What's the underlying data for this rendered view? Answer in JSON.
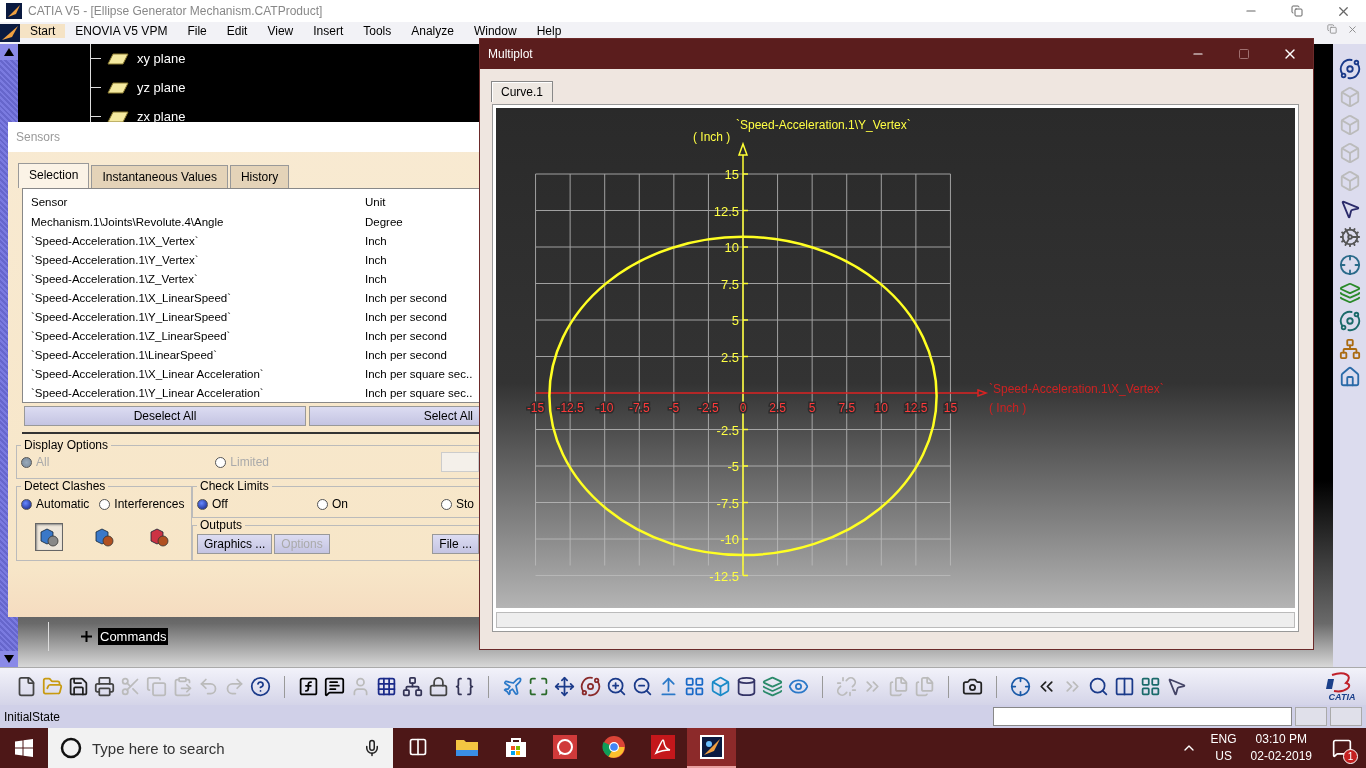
{
  "window": {
    "title": "CATIA V5 - [Ellipse Generator Mechanism.CATProduct]"
  },
  "menu": [
    {
      "label": "Start",
      "selected": true
    },
    {
      "label": "ENOVIA V5 VPM",
      "selected": false
    },
    {
      "label": "File",
      "selected": false
    },
    {
      "label": "Edit",
      "selected": false
    },
    {
      "label": "View",
      "selected": false
    },
    {
      "label": "Insert",
      "selected": false
    },
    {
      "label": "Tools",
      "selected": false
    },
    {
      "label": "Analyze",
      "selected": false
    },
    {
      "label": "Window",
      "selected": false
    },
    {
      "label": "Help",
      "selected": false
    }
  ],
  "tree": {
    "items": [
      {
        "label": "xy plane",
        "kind": "plane"
      },
      {
        "label": "yz plane",
        "kind": "plane"
      },
      {
        "label": "zx plane",
        "kind": "plane"
      },
      {
        "label": "Commands",
        "kind": "set",
        "expanded": false
      }
    ]
  },
  "sensors": {
    "title": "Sensors",
    "tabs": [
      {
        "label": "Selection",
        "selected": true
      },
      {
        "label": "Instantaneous Values",
        "selected": false
      },
      {
        "label": "History",
        "selected": false
      }
    ],
    "columns": [
      "Sensor",
      "Unit"
    ],
    "rows": [
      {
        "sensor": "Mechanism.1\\Joints\\Revolute.4\\Angle",
        "unit": "Degree"
      },
      {
        "sensor": "`Speed-Acceleration.1\\X_Vertex`",
        "unit": "Inch"
      },
      {
        "sensor": "`Speed-Acceleration.1\\Y_Vertex`",
        "unit": "Inch"
      },
      {
        "sensor": "`Speed-Acceleration.1\\Z_Vertex`",
        "unit": "Inch"
      },
      {
        "sensor": "`Speed-Acceleration.1\\X_LinearSpeed`",
        "unit": "Inch per second"
      },
      {
        "sensor": "`Speed-Acceleration.1\\Y_LinearSpeed`",
        "unit": "Inch per second"
      },
      {
        "sensor": "`Speed-Acceleration.1\\Z_LinearSpeed`",
        "unit": "Inch per second"
      },
      {
        "sensor": "`Speed-Acceleration.1\\LinearSpeed`",
        "unit": "Inch per second"
      },
      {
        "sensor": "`Speed-Acceleration.1\\X_Linear Acceleration`",
        "unit": "Inch per square sec.."
      },
      {
        "sensor": "`Speed-Acceleration.1\\Y_Linear Acceleration`",
        "unit": "Inch per square sec.."
      }
    ],
    "buttons": [
      "Deselect All",
      "Select All"
    ],
    "display_options": {
      "title": "Display Options",
      "options": [
        {
          "label": "All",
          "selected": true,
          "disabled": true
        },
        {
          "label": "Limited",
          "selected": false,
          "disabled": true
        }
      ]
    },
    "detect_clashes": {
      "title": "Detect Clashes",
      "options": [
        {
          "label": "Automatic",
          "selected": true
        },
        {
          "label": "Interferences",
          "selected": false
        }
      ],
      "tools": [
        {
          "pressed": true
        },
        {
          "pressed": false
        },
        {
          "pressed": false
        }
      ]
    },
    "check_limits": {
      "title": "Check Limits",
      "options": [
        {
          "label": "Off",
          "selected": true
        },
        {
          "label": "On",
          "selected": false
        },
        {
          "label": "Sto",
          "selected": false
        }
      ]
    },
    "outputs": {
      "title": "Outputs",
      "buttons": [
        {
          "label": "Graphics ...",
          "disabled": false
        },
        {
          "label": "Options",
          "disabled": true
        },
        {
          "label": "File ...",
          "disabled": false
        }
      ]
    }
  },
  "multiplot": {
    "title": "Multiplot",
    "tabs": [
      {
        "label": "Curve.1",
        "selected": true
      }
    ],
    "x_unit": "( Inch )",
    "y_unit": "( Inch )",
    "chart_data": {
      "type": "line",
      "xlabel": "`Speed-Acceleration.1\\X_Vertex`",
      "ylabel": "`Speed-Acceleration.1\\Y_Vertex`",
      "xlim": [
        -15,
        15
      ],
      "ylim": [
        -12.5,
        15
      ],
      "xticks": [
        -15,
        -12.5,
        -10,
        -7.5,
        -5,
        -2.5,
        0,
        2.5,
        5,
        7.5,
        10,
        12.5,
        15
      ],
      "yticks": [
        -12.5,
        -10,
        -7.5,
        -5,
        -2.5,
        2.5,
        5,
        7.5,
        10,
        12.5,
        15
      ],
      "grid": true
    }
  },
  "status_bar": {
    "text": "InitialState"
  },
  "logo_text": "CATIA",
  "taskbar": {
    "search_placeholder": "Type here to search",
    "apps": [
      {
        "kind": "folder",
        "selected": false
      },
      {
        "kind": "store",
        "selected": false
      },
      {
        "kind": "whatsapp",
        "selected": false
      },
      {
        "kind": "chrome",
        "selected": false
      },
      {
        "kind": "acrobat",
        "selected": false
      },
      {
        "kind": "catia",
        "selected": true
      }
    ],
    "language": "ENG",
    "region": "US",
    "time": "03:10 PM",
    "date": "02-02-2019",
    "notifications": "1"
  }
}
